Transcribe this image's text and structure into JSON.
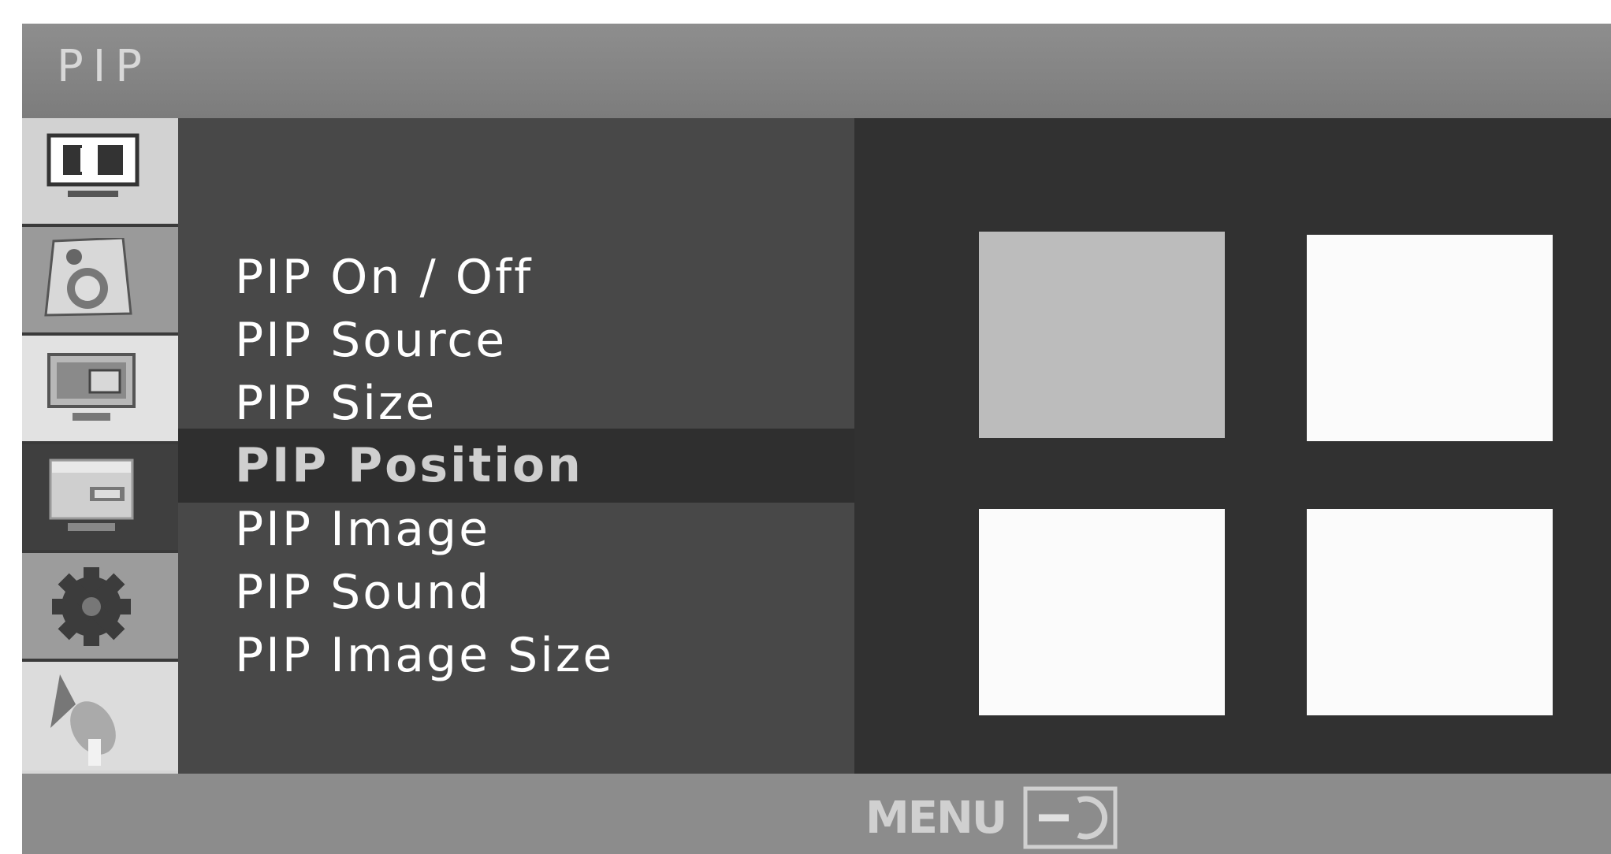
{
  "header": {
    "title": "PIP"
  },
  "sidebar": {
    "tabs": [
      {
        "name": "picture",
        "icon": "picture-icon",
        "active": false
      },
      {
        "name": "sound",
        "icon": "speaker-icon",
        "active": false
      },
      {
        "name": "pip",
        "icon": "pip-icon",
        "active": true
      },
      {
        "name": "screen",
        "icon": "screen-icon",
        "active": false
      },
      {
        "name": "option",
        "icon": "gear-icon",
        "active": false
      },
      {
        "name": "setup",
        "icon": "satellite-icon",
        "active": false
      }
    ]
  },
  "menu": {
    "items": [
      {
        "label": "PIP On / Off",
        "selected": false
      },
      {
        "label": "PIP Source",
        "selected": false
      },
      {
        "label": "PIP Size",
        "selected": false
      },
      {
        "label": "PIP Position",
        "selected": true
      },
      {
        "label": "PIP Image",
        "selected": false
      },
      {
        "label": "PIP Sound",
        "selected": false
      },
      {
        "label": "PIP Image Size",
        "selected": false
      }
    ]
  },
  "preview": {
    "positions": [
      {
        "name": "top-left",
        "selected": true
      },
      {
        "name": "top-right",
        "selected": false
      },
      {
        "name": "bottom-left",
        "selected": false
      },
      {
        "name": "bottom-right",
        "selected": false
      }
    ]
  },
  "footer": {
    "menu_label": "MENU",
    "menu_icon": "return-icon"
  },
  "colors": {
    "panel": "#484848",
    "preview_bg": "#313131",
    "selected_row": "#2f2f2f",
    "selected_box": "#bcbcbc",
    "title_bar": "#808080",
    "footer": "#8c8c8c"
  }
}
